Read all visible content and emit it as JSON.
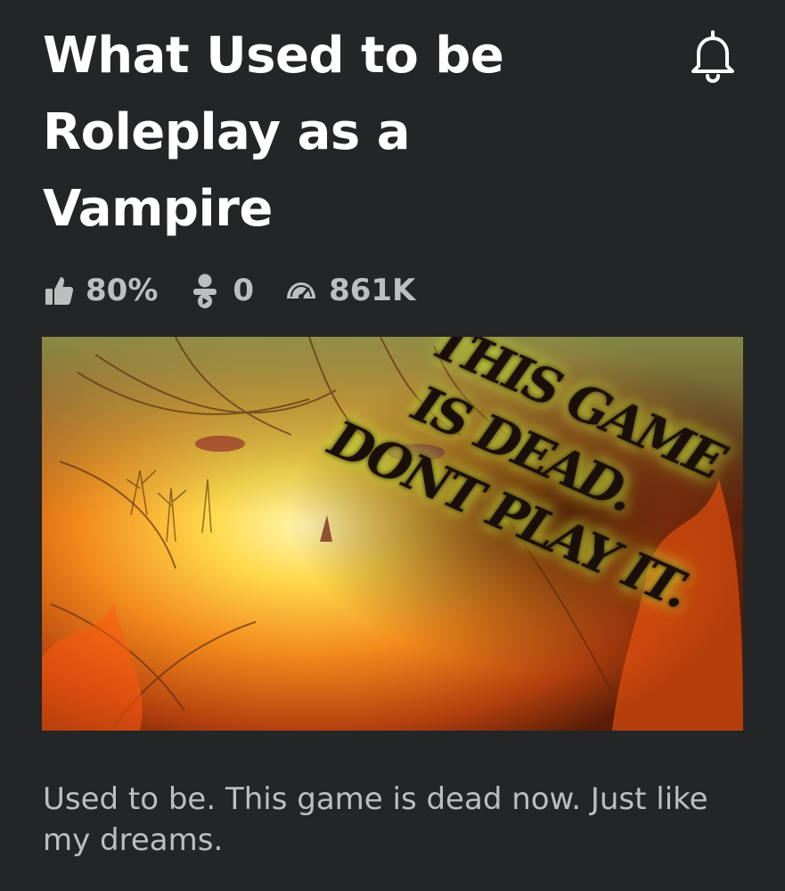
{
  "game": {
    "title": "What Used to be Roleplay as a Vampire",
    "description": "Used to be. This game is dead now. Just like my dreams."
  },
  "stats": {
    "rating": "80%",
    "playing": "0",
    "visits": "861K"
  },
  "thumbnail": {
    "overlay_lines": [
      "This game",
      "is dead.",
      "dont play it."
    ]
  },
  "icons": {
    "notify": "bell-icon",
    "rating": "thumbs-up-icon",
    "playing": "players-icon",
    "visits": "visits-gauge-icon"
  },
  "colors": {
    "background": "#232527",
    "title": "#ffffff",
    "secondary_text": "#bdbebe"
  }
}
